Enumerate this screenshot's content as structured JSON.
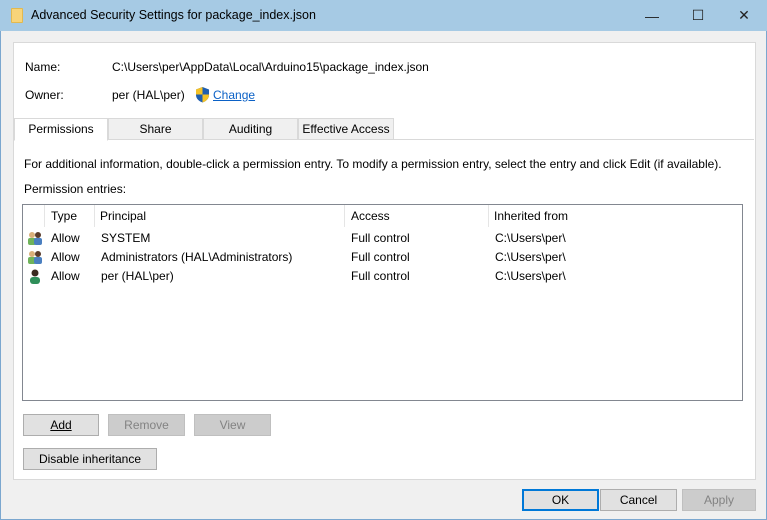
{
  "window": {
    "title": "Advanced Security Settings for package_index.json"
  },
  "name_label": "Name:",
  "name_value": "C:\\Users\\per\\AppData\\Local\\Arduino15\\package_index.json",
  "owner_label": "Owner:",
  "owner_value": "per (HAL\\per)",
  "change_link": "Change",
  "tabs": [
    "Permissions",
    "Share",
    "Auditing",
    "Effective Access"
  ],
  "info_text": "For additional information, double-click a permission entry. To modify a permission entry, select the entry and click Edit (if available).",
  "entries_label": "Permission entries:",
  "columns": [
    "Type",
    "Principal",
    "Access",
    "Inherited from"
  ],
  "rows": [
    {
      "icon": "group-icon",
      "type": "Allow",
      "principal": "SYSTEM",
      "access": "Full control",
      "inherited": "C:\\Users\\per\\"
    },
    {
      "icon": "group-icon",
      "type": "Allow",
      "principal": "Administrators (HAL\\Administrators)",
      "access": "Full control",
      "inherited": "C:\\Users\\per\\"
    },
    {
      "icon": "user-icon",
      "type": "Allow",
      "principal": "per (HAL\\per)",
      "access": "Full control",
      "inherited": "C:\\Users\\per\\"
    }
  ],
  "buttons": {
    "add": "Add",
    "remove": "Remove",
    "view": "View",
    "disable_inheritance": "Disable inheritance",
    "ok": "OK",
    "cancel": "Cancel",
    "apply": "Apply"
  }
}
